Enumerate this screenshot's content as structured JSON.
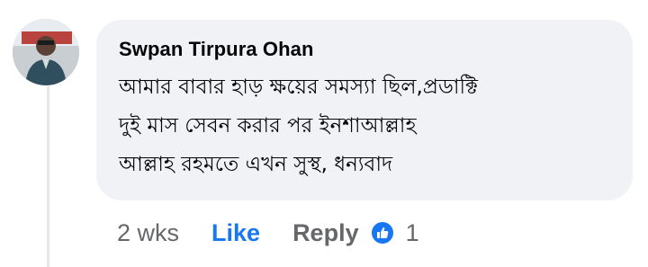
{
  "comment": {
    "author": "Swpan Tirpura Ohan",
    "lines": [
      "আমার বাবার হাড় ক্ষয়ের সমস্যা ছিল,প্রডাক্টি",
      "দুই মাস সেবন করার পর ইনশাআল্লাহ",
      "আল্লাহ রহমতে এখন সুস্থ, ধন্যবাদ"
    ]
  },
  "actions": {
    "time": "2 wks",
    "like_label": "Like",
    "reply_label": "Reply",
    "reaction_count": "1"
  },
  "colors": {
    "like": "#1877f2",
    "muted": "#65676b",
    "bubble": "#f0f2f5"
  }
}
